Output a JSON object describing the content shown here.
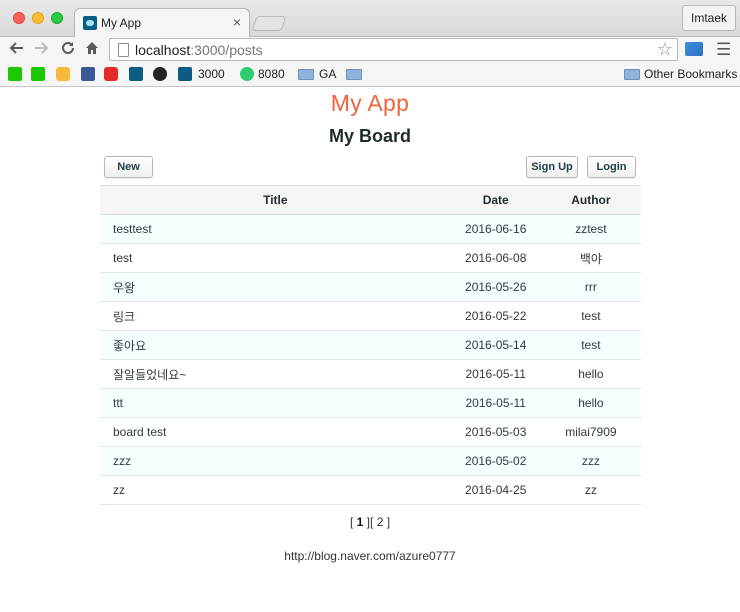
{
  "browser": {
    "tab_title": "My App",
    "tab_close": "×",
    "profile_name": "Imtaek",
    "url_host": "localhost",
    "url_path": ":3000/posts",
    "bookmarks": {
      "b3000": "3000",
      "b8080": "8080",
      "ga": "GA",
      "other": "Other Bookmarks"
    }
  },
  "header": {
    "app_title": "My App",
    "board_title": "My Board"
  },
  "actions": {
    "new_label": "New",
    "signup_label": "Sign Up",
    "login_label": "Login"
  },
  "table": {
    "headers": {
      "title": "Title",
      "date": "Date",
      "author": "Author"
    },
    "rows": [
      {
        "title": "testtest",
        "date": "2016-06-16",
        "author": "zztest"
      },
      {
        "title": "test",
        "date": "2016-06-08",
        "author": "백야"
      },
      {
        "title": "우왕",
        "date": "2016-05-26",
        "author": "rrr"
      },
      {
        "title": "링크",
        "date": "2016-05-22",
        "author": "test"
      },
      {
        "title": "좋아요",
        "date": "2016-05-14",
        "author": "test"
      },
      {
        "title": "잘알들었네요~",
        "date": "2016-05-11",
        "author": "hello"
      },
      {
        "title": "ttt",
        "date": "2016-05-11",
        "author": "hello"
      },
      {
        "title": "board test",
        "date": "2016-05-03",
        "author": "milai7909"
      },
      {
        "title": "zzz",
        "date": "2016-05-02",
        "author": "zzz"
      },
      {
        "title": "zz",
        "date": "2016-04-25",
        "author": "zz"
      }
    ]
  },
  "pagination": {
    "open1": "[",
    "page1": "1",
    "close1": "]",
    "open2": "[",
    "page2": "2",
    "close2": "]"
  },
  "footer": {
    "link": "http://blog.naver.com/azure0777"
  },
  "colors": {
    "accent": "#f0643c",
    "row_alt": "#f4ffff"
  }
}
